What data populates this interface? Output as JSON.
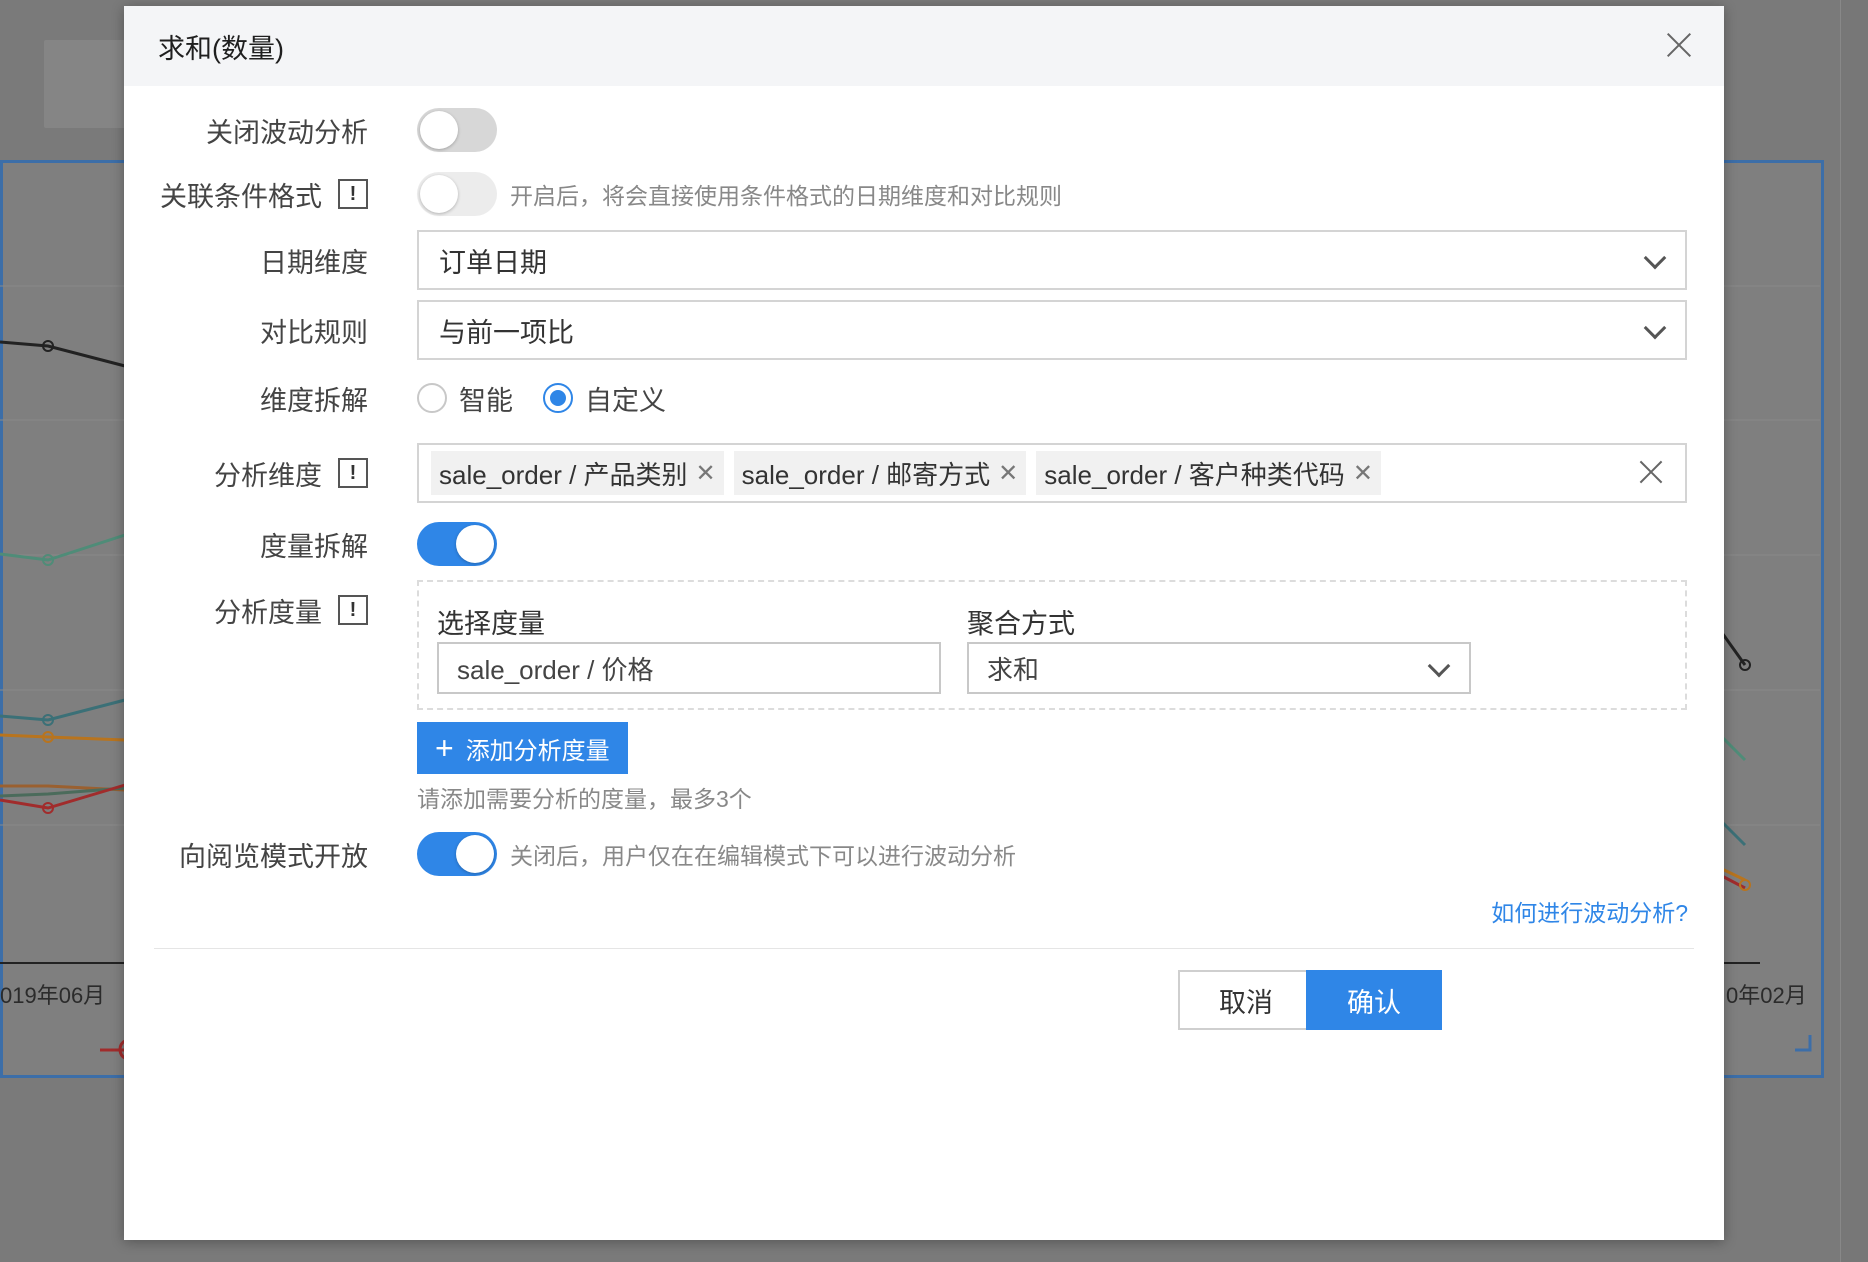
{
  "background": {
    "x_tick_left": "019年06月",
    "x_tick_right": "0年02月"
  },
  "modal": {
    "title": "求和(数量)",
    "fields": {
      "close_analysis": {
        "label": "关闭波动分析",
        "enabled": false
      },
      "link_condition": {
        "label": "关联条件格式",
        "enabled": false,
        "hint": "开启后，将会直接使用条件格式的日期维度和对比规则"
      },
      "date_dim": {
        "label": "日期维度",
        "value": "订单日期"
      },
      "compare_rule": {
        "label": "对比规则",
        "value": "与前一项比"
      },
      "dim_decompose": {
        "label": "维度拆解",
        "options": [
          "智能",
          "自定义"
        ],
        "selected": "自定义"
      },
      "analysis_dim": {
        "label": "分析维度",
        "tags": [
          "sale_order / 产品类别",
          "sale_order / 邮寄方式",
          "sale_order / 客户种类代码"
        ]
      },
      "measure_decompose": {
        "label": "度量拆解",
        "enabled": true
      },
      "analysis_measure": {
        "label": "分析度量",
        "select_label": "选择度量",
        "agg_label": "聚合方式",
        "measure_value": "sale_order / 价格",
        "agg_value": "求和",
        "add_button": "添加分析度量",
        "hint": "请添加需要分析的度量，最多3个"
      },
      "open_to_view": {
        "label": "向阅览模式开放",
        "enabled": true,
        "hint": "关闭后，用户仅在在编辑模式下可以进行波动分析"
      }
    },
    "help_link": "如何进行波动分析?",
    "buttons": {
      "cancel": "取消",
      "confirm": "确认"
    }
  },
  "colors": {
    "primary": "#2f86e7",
    "chart_border": "#3c6ea8"
  }
}
